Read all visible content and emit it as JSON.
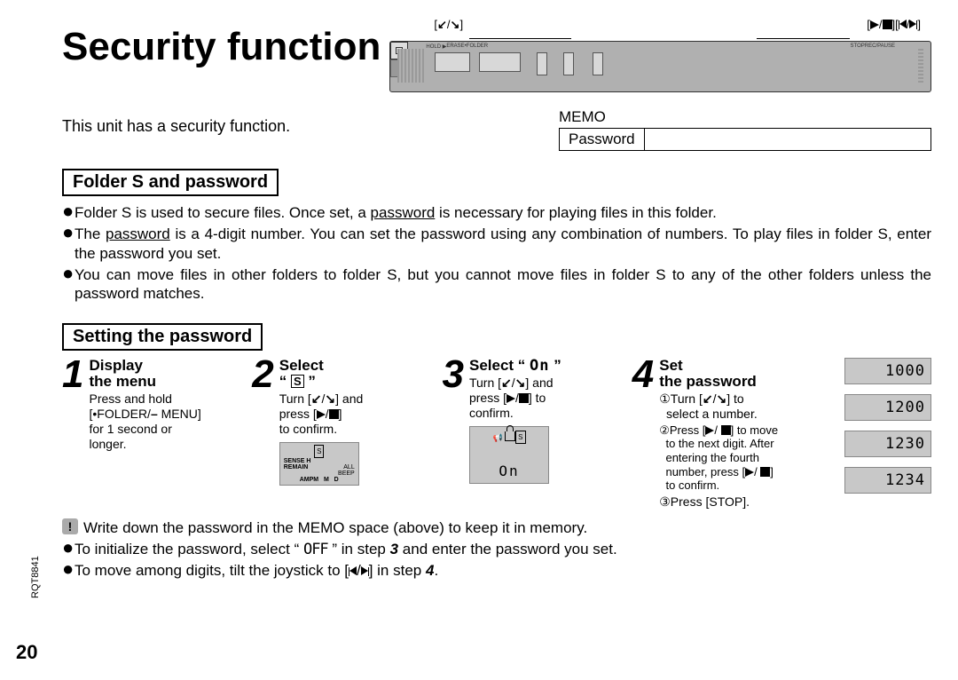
{
  "title": "Security function",
  "device": {
    "annot_left": "[   /   ]",
    "annot_right": "[   /   ][   /   ]",
    "labels": [
      "HOLD ▶",
      "ERASE",
      "•FOLDER",
      "STOP",
      "REC/PAUSE"
    ]
  },
  "intro": "This unit has a security function.",
  "memo": {
    "title": "MEMO",
    "row": "Password"
  },
  "section1": {
    "heading": "Folder S and password",
    "bullets": [
      "Folder S is used to secure files. Once set, a password is necessary for playing files in this folder.",
      "The password is a 4-digit number. You can set the password using any combination of numbers. To play files in folder S, enter the password you set.",
      "You can move files in other folders to folder S, but you cannot move files in folder S to any of the other folders unless the password matches."
    ]
  },
  "section2": {
    "heading": "Setting the password",
    "steps": [
      {
        "n": "1",
        "title1": "Display",
        "title2": "the menu",
        "desc": "Press and hold\n[•FOLDER/– MENU]\nfor 1 second or\nlonger."
      },
      {
        "n": "2",
        "title1": "Select",
        "title2": "“ S ”",
        "desc": "Turn [   /   ] and\npress [   /   ]\nto confirm.",
        "lcd": [
          "S",
          "SENSE H",
          "ALL",
          "REMAIN",
          "BEEP",
          "AMPM   M   D"
        ]
      },
      {
        "n": "3",
        "title1": "Select “ On ”",
        "title2": "",
        "desc": "Turn [   /   ] and\npress [   /   ] to\nconfirm.",
        "lcd_on": "On",
        "lcd_s": "S"
      },
      {
        "n": "4",
        "title1": "Set",
        "title2": "the password",
        "desc1": "①Turn [   /   ] to\n  select a number.",
        "desc2": "②Press [   /   ] to move\n  to the next digit. After\n  entering the fourth\n  number, press [   /   ]\n  to confirm.",
        "desc3": "③Press [STOP]."
      }
    ],
    "lcd_values": [
      "1000",
      "1200",
      "1230",
      "1234"
    ]
  },
  "notes": [
    "Write down the password in the MEMO space (above) to keep it in memory.",
    "To initialize the password, select “ OFF ” in step 3 and enter the password you set.",
    "To move among digits, tilt the joystick to [   /   ] in step 4."
  ],
  "page_num": "20",
  "part_num": "RQT8841"
}
